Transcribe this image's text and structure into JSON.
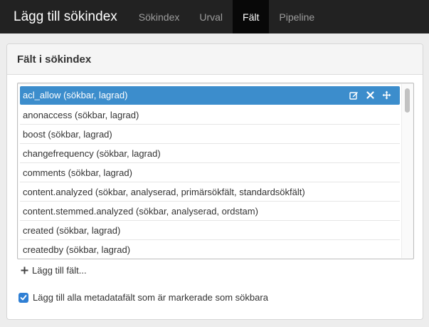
{
  "navbar": {
    "brand": "Lägg till sökindex",
    "tabs": [
      {
        "label": "Sökindex",
        "active": false
      },
      {
        "label": "Urval",
        "active": false
      },
      {
        "label": "Fält",
        "active": true
      },
      {
        "label": "Pipeline",
        "active": false
      }
    ]
  },
  "panel": {
    "title": "Fält i sökindex",
    "fields": [
      "acl_allow (sökbar, lagrad)",
      "anonaccess (sökbar, lagrad)",
      "boost (sökbar, lagrad)",
      "changefrequency (sökbar, lagrad)",
      "comments (sökbar, lagrad)",
      "content.analyzed (sökbar, analyserad, primärsökfält, standardsökfält)",
      "content.stemmed.analyzed (sökbar, analyserad, ordstam)",
      "created (sökbar, lagrad)",
      "createdby (sökbar, lagrad)"
    ],
    "selected_index": 0,
    "add_field_label": "Lägg till fält...",
    "metadata_checkbox_label": "Lägg till alla metadatafält som är markerade som sökbara",
    "metadata_checked": true
  },
  "colors": {
    "navbar_bg": "#222222",
    "selected_row": "#3c8dcc",
    "checkbox": "#2f7fd4"
  },
  "icons": {
    "edit": "edit-icon",
    "remove": "close-icon",
    "move": "move-icon",
    "add": "plus-icon",
    "check": "check-icon"
  }
}
